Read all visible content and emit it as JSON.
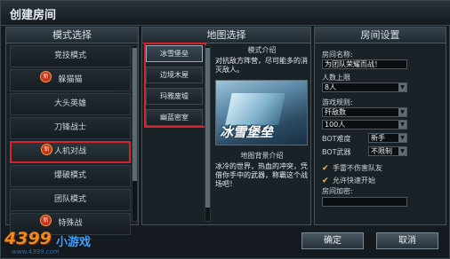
{
  "window": {
    "title": "创建房间"
  },
  "left_panel": {
    "title": "模式选择",
    "items": [
      {
        "label": "竞技模式",
        "new": ""
      },
      {
        "label": "躲猫猫",
        "new": "新"
      },
      {
        "label": "大头英雄",
        "new": ""
      },
      {
        "label": "刀锋战士",
        "new": ""
      },
      {
        "label": "人机对战",
        "new": "新"
      },
      {
        "label": "爆破模式",
        "new": ""
      },
      {
        "label": "团队模式",
        "new": ""
      },
      {
        "label": "特殊战",
        "new": "新"
      }
    ]
  },
  "mid_panel": {
    "title": "地图选择",
    "maps": [
      "冰雪堡垒",
      "边境木屋",
      "玛雅废墟",
      "幽蓝密室"
    ],
    "mode_intro_label": "模式介绍",
    "mode_intro_text": "对抗敌方阵营，尽可能多的消灭敌人。",
    "preview_title": "冰雪堡垒",
    "bg_label": "地图背景介绍",
    "bg_text": "冰冷的世界，热血的冲突，凭借你手中的武器，称霸这个战场吧！"
  },
  "right_panel": {
    "title": "房间设置",
    "room_name_label": "房间名称:",
    "room_name_value": "为团队荣耀而战！",
    "people_limit_label": "人数上限",
    "people_limit_value": "8人",
    "rule_label": "游戏规则:",
    "rule_value": "歼敌数",
    "rule_count": "100人",
    "bot_difficulty_label": "BOT难度",
    "bot_difficulty_value": "新手",
    "bot_weapon_label": "BOT武器",
    "bot_weapon_value": "不限制",
    "chk1": "手雷不伤害队友",
    "chk2": "允许快速开始",
    "password_label": "房间加密:"
  },
  "buttons": {
    "confirm": "确定",
    "cancel": "取消"
  },
  "logo": {
    "brand": "4399",
    "games": "小游戏",
    "url": "www.4399.com"
  }
}
